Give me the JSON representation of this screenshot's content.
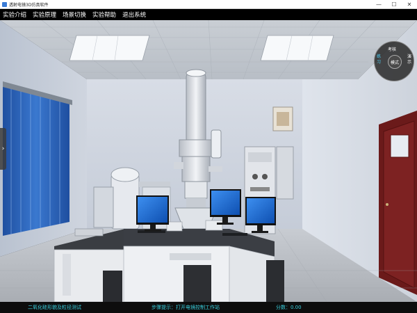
{
  "window": {
    "title": "透射电镜3D仿真软件",
    "minimize": "—",
    "maximize": "☐",
    "close": "✕"
  },
  "menu": {
    "items": [
      "实验介绍",
      "实验原理",
      "场景切换",
      "实验帮助",
      "退出系统"
    ]
  },
  "mode_wheel": {
    "center": "模式",
    "options": {
      "exam": "考核",
      "practice": "练习",
      "demo": "演示"
    },
    "active": "practice"
  },
  "status": {
    "experiment": "二氧化硅形貌及粒径测试",
    "step_hint": "步骤提示：打开电镜控制工作站",
    "score": "分数：0.00"
  },
  "colors": {
    "status_text": "#3ad1e0",
    "active_mode": "#4fd7ff",
    "monitor_screen": "#1d6fd8"
  }
}
